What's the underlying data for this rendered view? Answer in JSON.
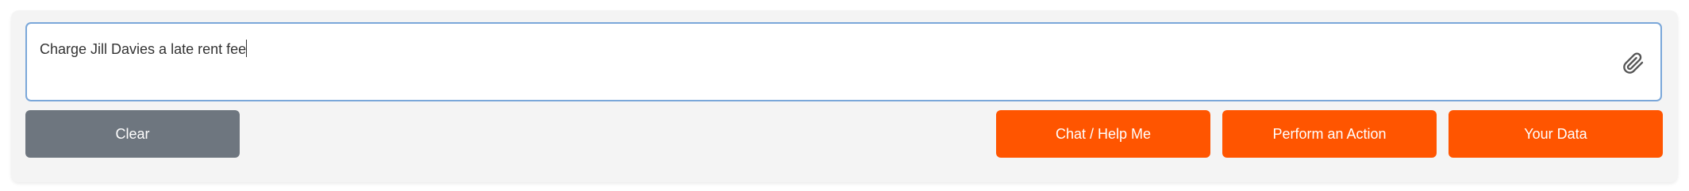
{
  "input": {
    "value": "Charge Jill Davies a late rent fee"
  },
  "buttons": {
    "clear": "Clear",
    "chat": "Chat / Help Me",
    "action": "Perform an Action",
    "data": "Your Data"
  },
  "icons": {
    "attach": "paperclip-icon"
  },
  "colors": {
    "primary": "#ff5500",
    "secondary": "#6e767f",
    "input_border": "#7aa7d9"
  }
}
